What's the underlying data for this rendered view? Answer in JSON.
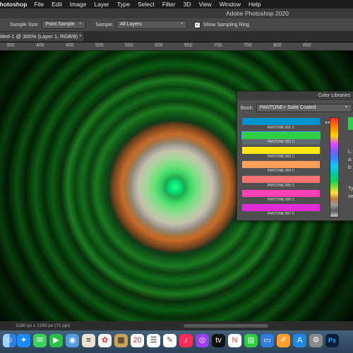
{
  "menubar": {
    "app": "Photoshop",
    "items": [
      "File",
      "Edit",
      "Image",
      "Layer",
      "Type",
      "Select",
      "Filter",
      "3D",
      "View",
      "Window",
      "Help"
    ]
  },
  "titlebar": {
    "title": "Adobe Photoshop 2020"
  },
  "options": {
    "sample_size_label": "Sample Size:",
    "sample_size_value": "Point Sample",
    "sample_label": "Sample:",
    "sample_value": "All Layers",
    "ring_label": "Show Sampling Ring",
    "ring_checked": true
  },
  "document_tab": {
    "label": "itled-1 @ 300% (Layer 1, RGB/8) *"
  },
  "ruler": {
    "ticks": [
      "350",
      "400",
      "450",
      "500",
      "550",
      "600",
      "650",
      "700",
      "750",
      "800",
      "850"
    ]
  },
  "status": {
    "dimensions": "1280 px x 1280 px (72 ppi)"
  },
  "color_libraries": {
    "title": "Color Libraries",
    "book_label": "Book:",
    "book_value": "PANTONE+ Solid Coated",
    "swatches": [
      {
        "name": "PANTONE 801 C",
        "color": "#0093d0"
      },
      {
        "name": "PANTONE 802 C",
        "color": "#2ecf40"
      },
      {
        "name": "PANTONE 803 C",
        "color": "#ffe70f"
      },
      {
        "name": "PANTONE 804 C",
        "color": "#ff9f5b"
      },
      {
        "name": "PANTONE 805 C",
        "color": "#ff7373"
      },
      {
        "name": "PANTONE 806 C",
        "color": "#ff3fb3"
      },
      {
        "name": "PANTONE 807 C",
        "color": "#e22ad6"
      }
    ],
    "selected_index": 1,
    "side_labels": [
      "L:",
      "a:",
      "b:",
      "Ty",
      "se"
    ]
  },
  "dock": {
    "icons": [
      "finder-icon",
      "safari-icon",
      "messages-icon",
      "facetime-icon",
      "photos-icon",
      "contacts-icon",
      "calendar-icon",
      "reminders-icon",
      "notes-icon",
      "music-icon",
      "podcasts-icon",
      "tv-icon",
      "news-icon",
      "numbers-icon",
      "keynote-icon",
      "pages-icon",
      "app-store-icon",
      "system-preferences-icon",
      "photoshop-icon"
    ],
    "calendar_day": "20"
  }
}
